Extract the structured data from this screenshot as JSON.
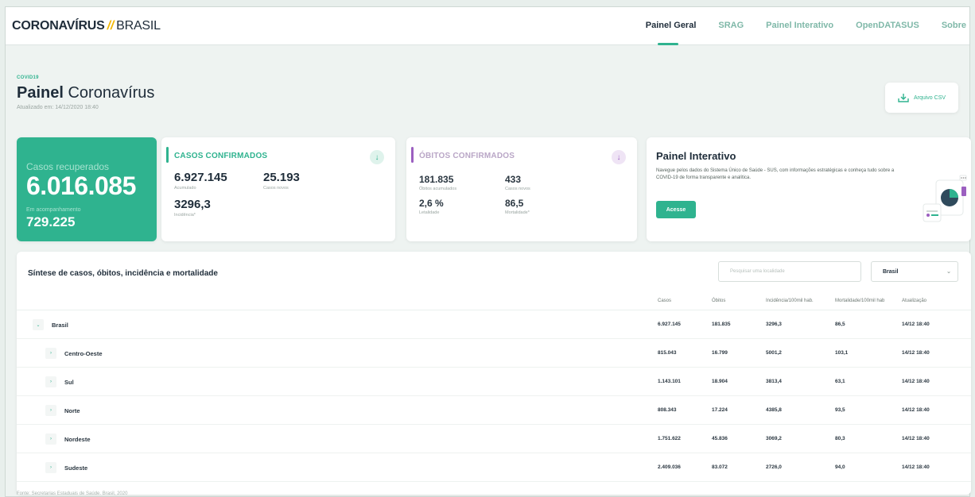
{
  "header": {
    "brand_main": "CORONAVÍRUS",
    "brand_slash": "//",
    "brand_country": "BRASIL",
    "nav": [
      {
        "label": "Painel Geral"
      },
      {
        "label": "SRAG"
      },
      {
        "label": "Painel Interativo"
      },
      {
        "label": "OpenDATASUS"
      },
      {
        "label": "Sobre"
      }
    ]
  },
  "page": {
    "eyebrow": "COVID19",
    "title_bold": "Painel",
    "title_rest": "Coronavírus",
    "updated": "Atualizado em: 14/12/2020 18:40",
    "csv_label": "Arquivo CSV"
  },
  "recuperados": {
    "label": "Casos recuperados",
    "value": "6.016.085",
    "sub_label": "Em acompanhamento",
    "sub_value": "729.225"
  },
  "confirmados": {
    "title": "CASOS CONFIRMADOS",
    "acumulado": "6.927.145",
    "acumulado_label": "Acumulado",
    "novos": "25.193",
    "novos_label": "Casos novos",
    "incidencia": "3296,3",
    "incidencia_label": "Incidência*"
  },
  "obitos": {
    "title": "ÓBITOS CONFIRMADOS",
    "acumulados": "181.835",
    "acumulados_label": "Óbitos acumulados",
    "novos": "433",
    "novos_label": "Casos novos",
    "letalidade": "2,6 %",
    "letalidade_label": "Letalidade",
    "mortalidade": "86,5",
    "mortalidade_label": "Mortalidade*"
  },
  "interativo": {
    "title": "Painel Interativo",
    "text": "Navegue pelos dados do Sistema Único de Saúde - SUS, com informações estratégicas e conheça tudo sobre a COVID-19 de forma transparente e analítica.",
    "button": "Acesse"
  },
  "table": {
    "title": "Síntese de casos, óbitos, incidência e mortalidade",
    "search_placeholder": "Pesquisar uma localidade",
    "select_value": "Brasil",
    "headers": [
      "Casos",
      "Óbitos",
      "Incidência/100mil hab.",
      "Mortalidade/100mil hab",
      "Atualização"
    ],
    "rows": [
      {
        "name": "Brasil",
        "casos": "6.927.145",
        "obitos": "181.835",
        "incidencia": "3296,3",
        "mortalidade": "86,5",
        "atualizacao": "14/12 18:40"
      },
      {
        "name": "Centro-Oeste",
        "casos": "815.043",
        "obitos": "16.799",
        "incidencia": "5001,2",
        "mortalidade": "103,1",
        "atualizacao": "14/12 18:40"
      },
      {
        "name": "Sul",
        "casos": "1.143.101",
        "obitos": "18.904",
        "incidencia": "3813,4",
        "mortalidade": "63,1",
        "atualizacao": "14/12 18:40"
      },
      {
        "name": "Norte",
        "casos": "808.343",
        "obitos": "17.224",
        "incidencia": "4385,8",
        "mortalidade": "93,5",
        "atualizacao": "14/12 18:40"
      },
      {
        "name": "Nordeste",
        "casos": "1.751.622",
        "obitos": "45.836",
        "incidencia": "3069,2",
        "mortalidade": "80,3",
        "atualizacao": "14/12 18:40"
      },
      {
        "name": "Sudeste",
        "casos": "2.409.036",
        "obitos": "83.072",
        "incidencia": "2726,0",
        "mortalidade": "94,0",
        "atualizacao": "14/12 18:40"
      }
    ]
  },
  "footer": "Fonte: Secretarias Estaduais de Saúde. Brasil, 2020",
  "colors": {
    "accent": "#2fb38f",
    "confirmados_bar": "#2fb38f",
    "obitos_bar": "#9b5fc0",
    "brand_slash": "#f2b705"
  }
}
